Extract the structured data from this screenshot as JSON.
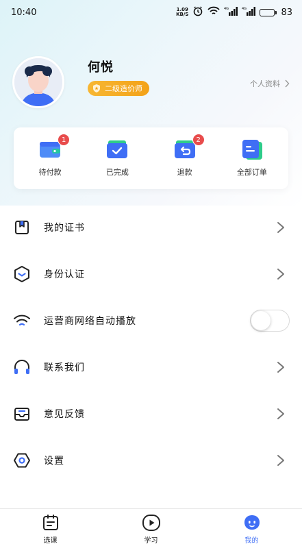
{
  "status_bar": {
    "time": "10:40",
    "net_speed_value": "1.09",
    "net_speed_unit": "KB/S",
    "battery": "83",
    "battery_level": 0.83
  },
  "profile": {
    "name": "何悦",
    "level_badge": "二级造价师",
    "profile_link": "个人资料"
  },
  "orders": [
    {
      "label": "待付款",
      "badge": "1",
      "icon": "wallet-icon"
    },
    {
      "label": "已完成",
      "badge": "",
      "icon": "check-folder-icon"
    },
    {
      "label": "退款",
      "badge": "2",
      "icon": "refund-icon"
    },
    {
      "label": "全部订单",
      "badge": "",
      "icon": "orders-list-icon"
    }
  ],
  "menu": [
    {
      "label": "我的证书",
      "icon": "certificate-icon",
      "control": "chevron"
    },
    {
      "label": "身份认证",
      "icon": "identity-hexagon-icon",
      "control": "chevron"
    },
    {
      "label": "运营商网络自动播放",
      "icon": "wifi-icon",
      "control": "toggle",
      "toggle_on": false
    },
    {
      "label": "联系我们",
      "icon": "headphones-icon",
      "control": "chevron"
    },
    {
      "label": "意见反馈",
      "icon": "feedback-inbox-icon",
      "control": "chevron"
    },
    {
      "label": "设置",
      "icon": "settings-hexagon-icon",
      "control": "chevron"
    }
  ],
  "bottom_nav": [
    {
      "label": "选课",
      "icon": "calendar-list-icon",
      "active": false
    },
    {
      "label": "学习",
      "icon": "play-icon",
      "active": false
    },
    {
      "label": "我的",
      "icon": "robot-face-icon",
      "active": true
    }
  ],
  "colors": {
    "accent": "#3f6ef5",
    "badge_red": "#e84c4c",
    "level_gold": "#f5a623"
  }
}
